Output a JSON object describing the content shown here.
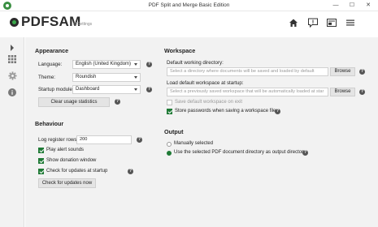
{
  "window": {
    "title": "PDF Split and Merge Basic Edition",
    "controls": {
      "minimize": "—",
      "maximize": "☐",
      "close": "✕"
    }
  },
  "header": {
    "logo": "PDFSAM",
    "subtitle": "@Settings",
    "icons": [
      "home-icon",
      "feedback-icon",
      "news-icon",
      "menu-icon"
    ]
  },
  "sidebar": {
    "items": [
      "expand-icon",
      "modules-icon",
      "settings-icon",
      "info-icon"
    ],
    "active": "settings-icon"
  },
  "appearance": {
    "heading": "Appearance",
    "language_label": "Language:",
    "language_value": "English (United Kingdom)",
    "theme_label": "Theme:",
    "theme_value": "Roundish",
    "startup_label": "Startup module:",
    "startup_value": "Dashboard",
    "clear_button": "Clear usage statistics",
    "help": "?"
  },
  "behaviour": {
    "heading": "Behaviour",
    "log_label": "Log register rows:",
    "log_value": "200",
    "play_alert": "Play alert sounds",
    "show_donation": "Show donation window",
    "check_updates": "Check for updates at startup",
    "check_now_button": "Check for updates now"
  },
  "workspace": {
    "heading": "Workspace",
    "default_dir_label": "Default working directory:",
    "default_dir_placeholder": "Select a directory where documents will be saved and loaded by default",
    "load_ws_label": "Load default workspace at startup:",
    "load_ws_placeholder": "Select a previously saved workspace that will be automatically loaded at star",
    "browse": "Browse",
    "save_on_exit": "Save default workspace on exit",
    "store_passwords": "Store passwords when saving a workspace file"
  },
  "output": {
    "heading": "Output",
    "manually": "Manually selected",
    "use_same_dir": "Use the selected PDF document directory as output directory"
  }
}
